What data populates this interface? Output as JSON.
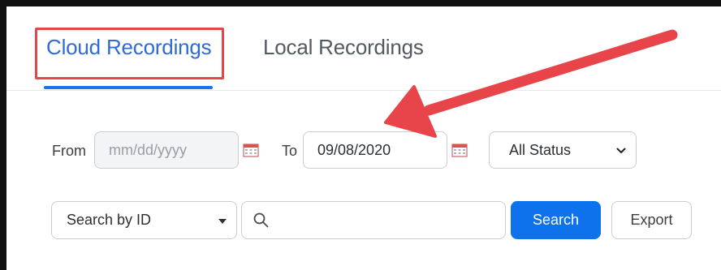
{
  "tabs": {
    "cloud": "Cloud Recordings",
    "local": "Local Recordings"
  },
  "filters": {
    "from_label": "From",
    "from_placeholder": "mm/dd/yyyy",
    "to_label": "To",
    "to_value": "09/08/2020",
    "status_selected": "All Status"
  },
  "search": {
    "type_selected": "Search by ID",
    "query_value": "",
    "search_button": "Search",
    "export_button": "Export"
  },
  "colors": {
    "accent": "#0e72ed",
    "highlight_box": "#e8454a",
    "arrow": "#e8454a"
  },
  "icons": [
    "calendar-icon",
    "chevron-down-icon",
    "search-icon",
    "arrow-annotation-icon"
  ]
}
